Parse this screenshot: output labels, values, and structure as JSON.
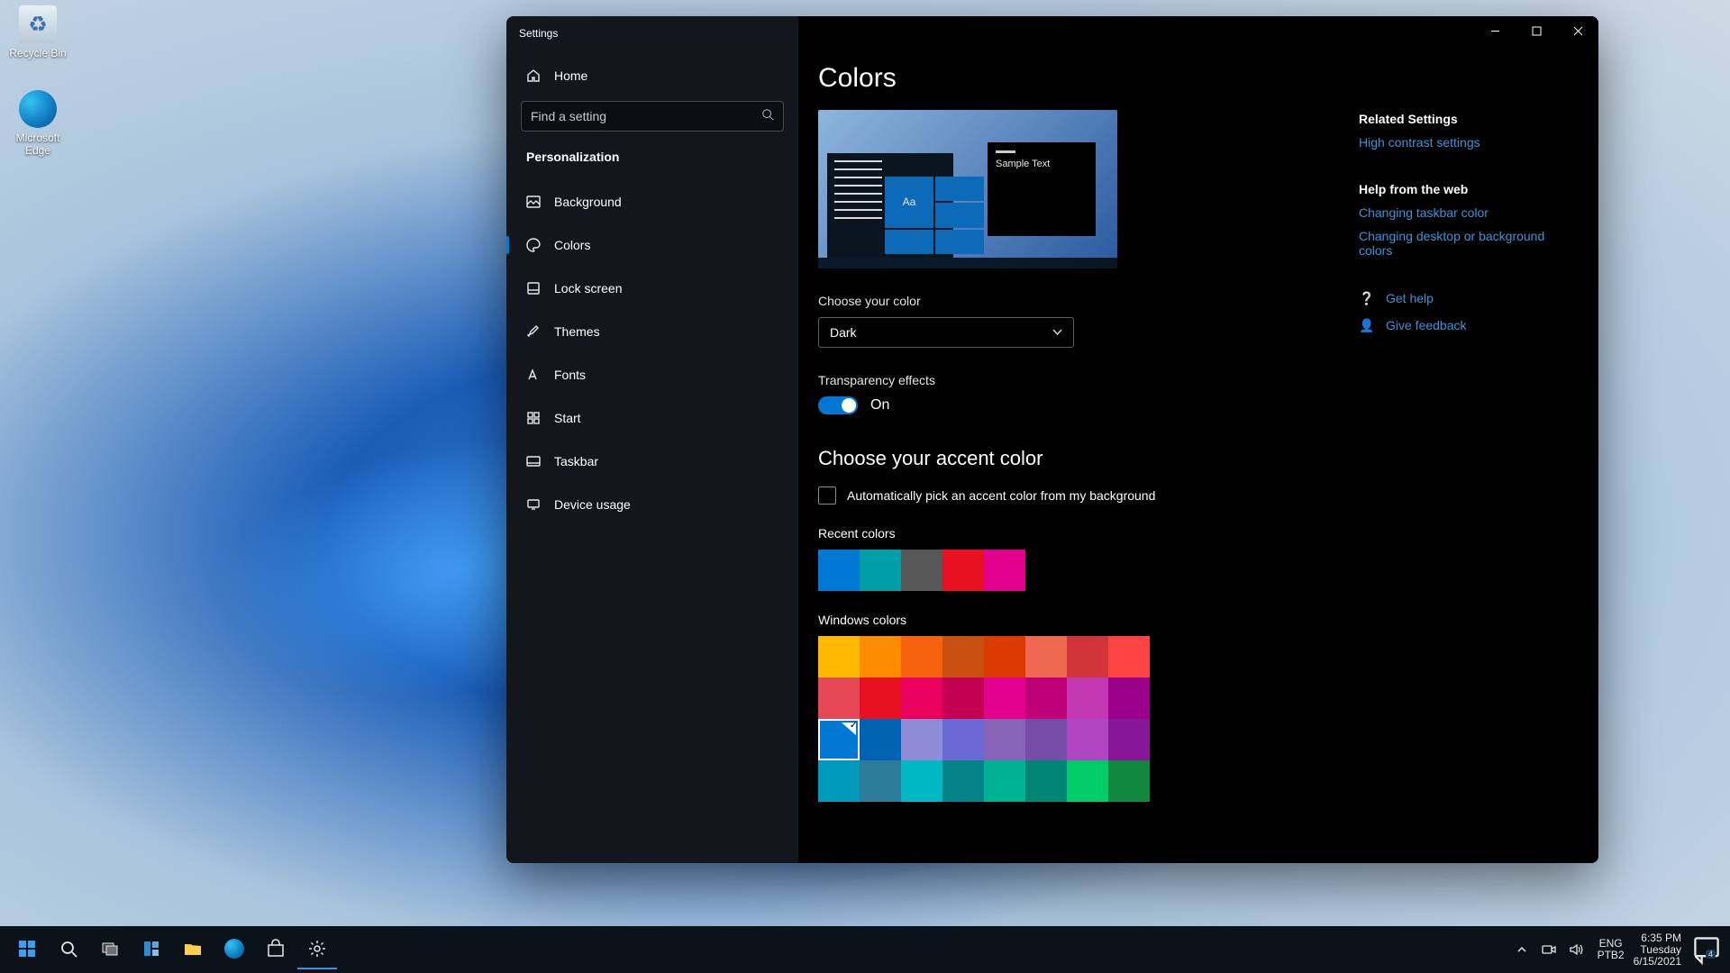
{
  "desktop": {
    "recycle": "Recycle Bin",
    "edge": "Microsoft Edge"
  },
  "window": {
    "title": "Settings",
    "home": "Home",
    "search_placeholder": "Find a setting",
    "section": "Personalization",
    "nav": {
      "background": "Background",
      "colors": "Colors",
      "lockscreen": "Lock screen",
      "themes": "Themes",
      "fonts": "Fonts",
      "start": "Start",
      "taskbar": "Taskbar",
      "deviceusage": "Device usage"
    }
  },
  "page": {
    "title": "Colors",
    "preview_sample": "Sample Text",
    "preview_tile": "Aa",
    "choose_color_lbl": "Choose your color",
    "choose_color_val": "Dark",
    "transparency_lbl": "Transparency effects",
    "transparency_val": "On",
    "accent_head": "Choose your accent color",
    "auto_accent": "Automatically pick an accent color from my background",
    "recent_lbl": "Recent colors",
    "recent_colors": [
      "#0078d4",
      "#009fa8",
      "#575757",
      "#e81123",
      "#e3008c"
    ],
    "windows_lbl": "Windows colors",
    "windows_colors": [
      "#ffb900",
      "#ff8c00",
      "#f7630c",
      "#ca5010",
      "#da3b01",
      "#ef6950",
      "#d13438",
      "#ff4343",
      "#e74856",
      "#e81123",
      "#ea005e",
      "#c30052",
      "#e3008c",
      "#bf0077",
      "#c239b3",
      "#9a0089",
      "#0078d4",
      "#0063b1",
      "#8e8cd8",
      "#6b69d6",
      "#8764b8",
      "#744da9",
      "#b146c2",
      "#881798",
      "#0099bc",
      "#2d7d9a",
      "#00b7c3",
      "#038387",
      "#00b294",
      "#018574",
      "#00cc6a",
      "#10893e"
    ],
    "windows_selected_index": 16
  },
  "side": {
    "related_h": "Related Settings",
    "related_link": "High contrast settings",
    "help_h": "Help from the web",
    "help_links": {
      "l1": "Changing taskbar color",
      "l2": "Changing desktop or background colors"
    },
    "gethelp": "Get help",
    "feedback": "Give feedback"
  },
  "taskbar": {
    "lang1": "ENG",
    "lang2": "PTB2",
    "time": "6:35 PM",
    "day": "Tuesday",
    "date": "6/15/2021",
    "notif_count": "4"
  }
}
